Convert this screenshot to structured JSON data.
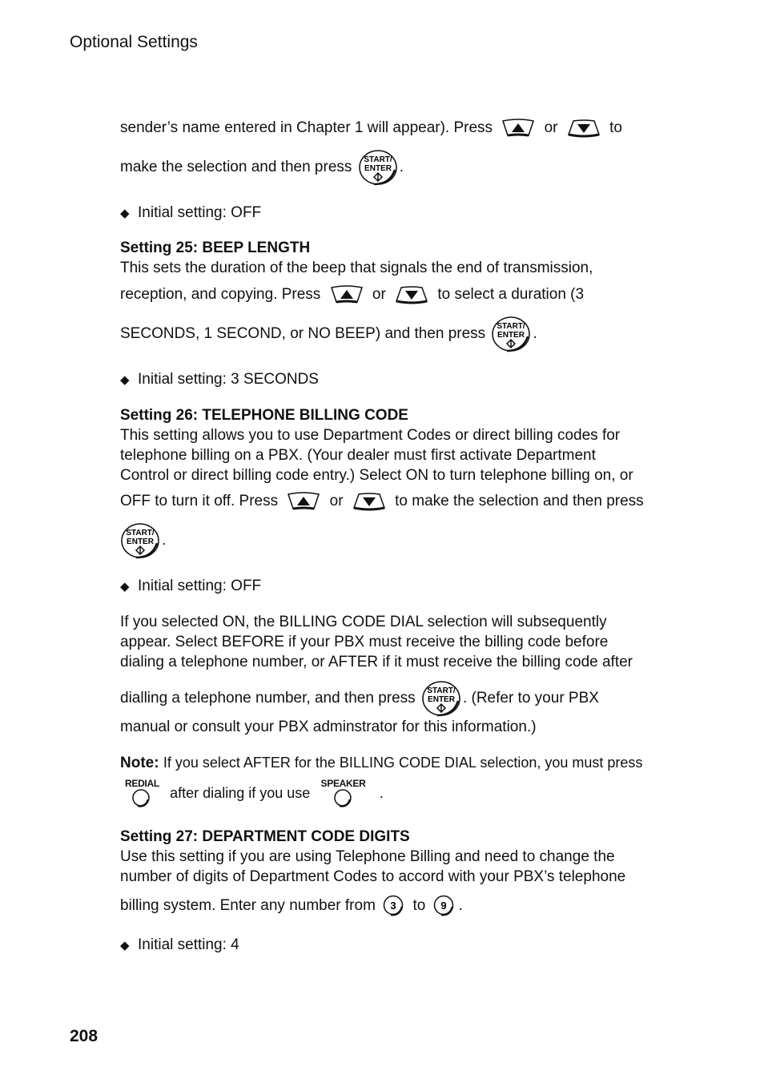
{
  "header": {
    "section_title": "Optional Settings"
  },
  "page_number": "208",
  "keys": {
    "start_enter_line1": "START/",
    "start_enter_line2": "ENTER",
    "redial": "REDIAL",
    "speaker": "SPEAKER",
    "num_3": "3",
    "num_9": "9"
  },
  "intro": {
    "line1_a": "sender’s name entered in Chapter 1 will appear). Press",
    "line1_or": "or",
    "line1_b": "to",
    "line2_a": "make the selection and then press",
    "line2_b": ".",
    "initial": "Initial setting: OFF"
  },
  "s25": {
    "title": "Setting 25: BEEP LENGTH",
    "line1": "This sets the duration of the beep that signals the end of transmission,",
    "line2_a": "reception, and copying. Press",
    "line2_or": "or",
    "line2_b": "to select a duration (3",
    "line3_a": "SECONDS, 1 SECOND, or NO BEEP) and then press",
    "line3_b": ".",
    "initial": "Initial setting: 3 SECONDS"
  },
  "s26": {
    "title": "Setting 26: TELEPHONE BILLING CODE",
    "line1": "This setting allows you to use Department Codes or direct billing codes for",
    "line2": "telephone billing on a PBX. (Your dealer must first activate Department",
    "line3": "Control or direct billing code entry.) Select ON to turn telephone billing on, or",
    "line4_a": "OFF to turn it off. Press",
    "line4_or": "or",
    "line4_b": "to make the selection and then press",
    "line5_b": ".",
    "initial": "Initial setting: OFF",
    "p2_line1": "If you selected ON, the BILLING CODE DIAL selection will subsequently",
    "p2_line2": "appear. Select BEFORE if your PBX must receive the billing code before",
    "p2_line3": "dialing a telephone number, or AFTER if it must receive the billing code after",
    "p2_line4_a": "dialling a telephone number, and then press",
    "p2_line4_b": ". (Refer to your PBX",
    "p2_line5": "manual or consult your PBX adminstrator for this information.)",
    "note_label": "Note:",
    "note_line1": "If you select AFTER for the BILLING CODE DIAL selection, you must press",
    "note_line2_a": "after dialing if you use",
    "note_line2_b": "."
  },
  "s27": {
    "title": "Setting 27: DEPARTMENT CODE DIGITS",
    "line1": "Use this setting if you are using Telephone Billing and need to change the",
    "line2": "number of digits of Department Codes to accord with your PBX’s telephone",
    "line3_a": "billing system. Enter any number from",
    "line3_to": "to",
    "line3_b": ".",
    "initial": "Initial setting: 4"
  }
}
